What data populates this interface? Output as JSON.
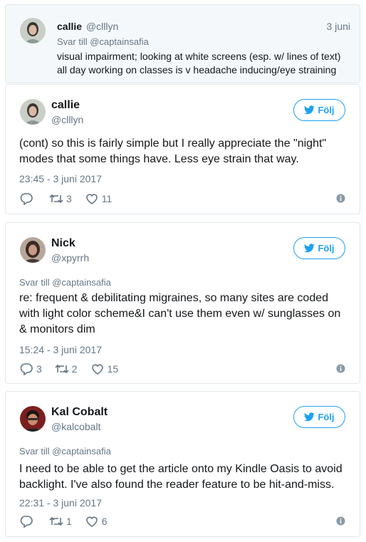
{
  "reply_context": {
    "name": "callie",
    "handle": "@clllyn",
    "date": "3 juni",
    "reply_to": "Svar till @captainsafia",
    "text": "visual impairment; looking at white screens (esp. w/ lines of text) all day working on classes is v headache inducing/eye straining"
  },
  "follow_label": "Följ",
  "tweets": [
    {
      "name": "callie",
      "handle": "@clllyn",
      "reply_to": "",
      "text": "(cont) so this is fairly simple but I really appreciate the \"night\" modes that some things have. Less eye strain that way.",
      "time": "23:45 - 3 juni 2017",
      "replies": "",
      "retweets": "3",
      "likes": "11"
    },
    {
      "name": "Nick",
      "handle": "@xpyrrh",
      "reply_to": "Svar till @captainsafia",
      "text": "re: frequent & debilitating migraines, so many sites are coded with light color scheme&I can't use them even w/ sunglasses on & monitors dim",
      "time": "15:24 - 3 juni 2017",
      "replies": "3",
      "retweets": "2",
      "likes": "15"
    },
    {
      "name": "Kal Cobalt",
      "handle": "@kalcobalt",
      "reply_to": "Svar till @captainsafia",
      "text": "I need to be able to get the article onto my Kindle Oasis to avoid backlight. I've also found the reader feature to be hit-and-miss.",
      "time": "22:31 - 3 juni 2017",
      "replies": "",
      "retweets": "1",
      "likes": "6"
    }
  ],
  "colors": {
    "accent": "#1da1f2",
    "secondary_text": "#657786",
    "border": "#e1e8ed",
    "reply_bg": "#f5f8fa"
  }
}
